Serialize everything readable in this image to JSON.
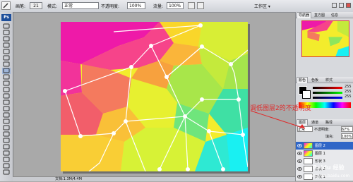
{
  "option_bar": {
    "brush_label": "画笔:",
    "brush_size": "21",
    "mode_label": "模式:",
    "mode_value": "正常",
    "opacity_label": "不透明度:",
    "opacity_value": "100%",
    "flow_label": "流量:",
    "flow_value": "100%",
    "workspace_label": "工作区 ▾"
  },
  "toolbox": {
    "logo": "Ps"
  },
  "status_bar": {
    "doc_size": "文档:1.3M/4.4M"
  },
  "navigator": {
    "tabs": [
      "导航器",
      "直方图",
      "信息"
    ]
  },
  "color_panel": {
    "tabs": [
      "颜色",
      "色板",
      "样式"
    ],
    "r_value": "255",
    "g_value": "255",
    "b_value": "255"
  },
  "layers_panel": {
    "tabs": [
      "图层",
      "通道",
      "路径"
    ],
    "blend_mode": "正常",
    "opacity_label": "不透明度:",
    "opacity_value": "67%",
    "fill_label": "填充:",
    "fill_value": "100%",
    "layers": [
      {
        "name": "图层 2",
        "selected": true
      },
      {
        "name": "图层 1",
        "selected": false
      },
      {
        "name": "形状 3",
        "selected": false
      },
      {
        "name": "形状 2",
        "selected": false
      },
      {
        "name": "形状 1",
        "selected": false
      }
    ]
  },
  "annotation": {
    "text": "调低图层2的不透明度",
    "color": "#e02a2a"
  },
  "watermark": {
    "brand": "Baidu 经验",
    "url": "jingyan.baidu.com"
  }
}
